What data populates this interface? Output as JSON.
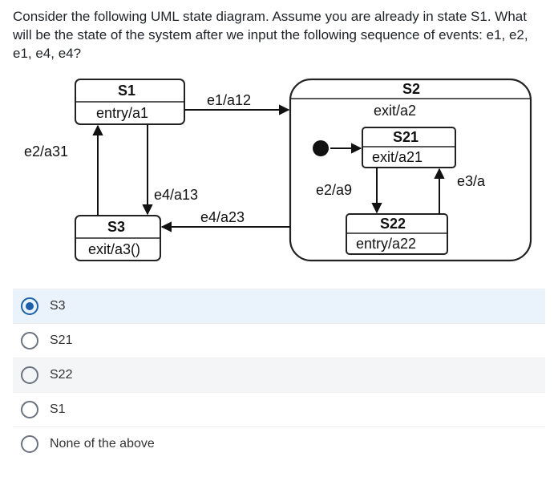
{
  "question_text": "Consider the following UML state diagram. Assume you are already in state S1. What will be the state of the system after we input the following sequence of events: e1, e2, e1, e4, e4?",
  "diagram": {
    "states": {
      "S1": {
        "title": "S1",
        "annotation": "entry/a1"
      },
      "S3": {
        "title": "S3",
        "annotation": "exit/a3()"
      },
      "S2": {
        "title": "S2",
        "annotation": "exit/a2",
        "substates": {
          "S21": {
            "title": "S21",
            "annotation": "exit/a21"
          },
          "S22": {
            "title": "S22",
            "annotation": "entry/a22"
          }
        }
      }
    },
    "transitions": {
      "e2_a31": "e2/a31",
      "e1_a12": "e1/a12",
      "e4_a13": "e4/a13",
      "e4_a23": "e4/a23",
      "e2_a9": "e2/a9",
      "e3_a": "e3/a"
    }
  },
  "options": [
    {
      "id": "s3",
      "label": "S3",
      "selected": true
    },
    {
      "id": "s21",
      "label": "S21",
      "selected": false
    },
    {
      "id": "s22",
      "label": "S22",
      "selected": false
    },
    {
      "id": "s1",
      "label": "S1",
      "selected": false
    },
    {
      "id": "none",
      "label": "None of the above",
      "selected": false
    }
  ]
}
